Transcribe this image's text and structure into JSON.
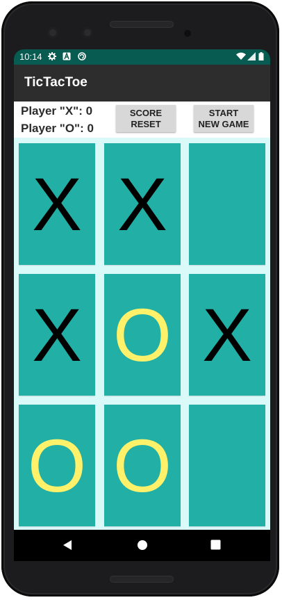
{
  "status_bar": {
    "time": "10:14",
    "icons": [
      "gear-icon",
      "a-icon",
      "circle-icon"
    ],
    "right_icons": [
      "wifi-icon",
      "signal-icon",
      "battery-icon"
    ],
    "color": "#075b51"
  },
  "app_bar": {
    "title": "TicTacToe",
    "color": "#2d2d2d"
  },
  "scores": {
    "player_x": "Player \"X\": 0",
    "player_o": "Player \"O\": 0"
  },
  "buttons": {
    "score_reset": "SCORE\nRESET",
    "new_game": "START\nNEW GAME"
  },
  "board": {
    "cells": [
      "X",
      "X",
      "",
      "X",
      "O",
      "X",
      "O",
      "O",
      ""
    ],
    "cell_color": "#22b0a6",
    "background_color": "#dafaf9",
    "x_color": "#000000",
    "o_color": "#fff16a"
  },
  "nav_bar": {
    "icons": [
      "back-icon",
      "home-icon",
      "recents-icon"
    ]
  }
}
